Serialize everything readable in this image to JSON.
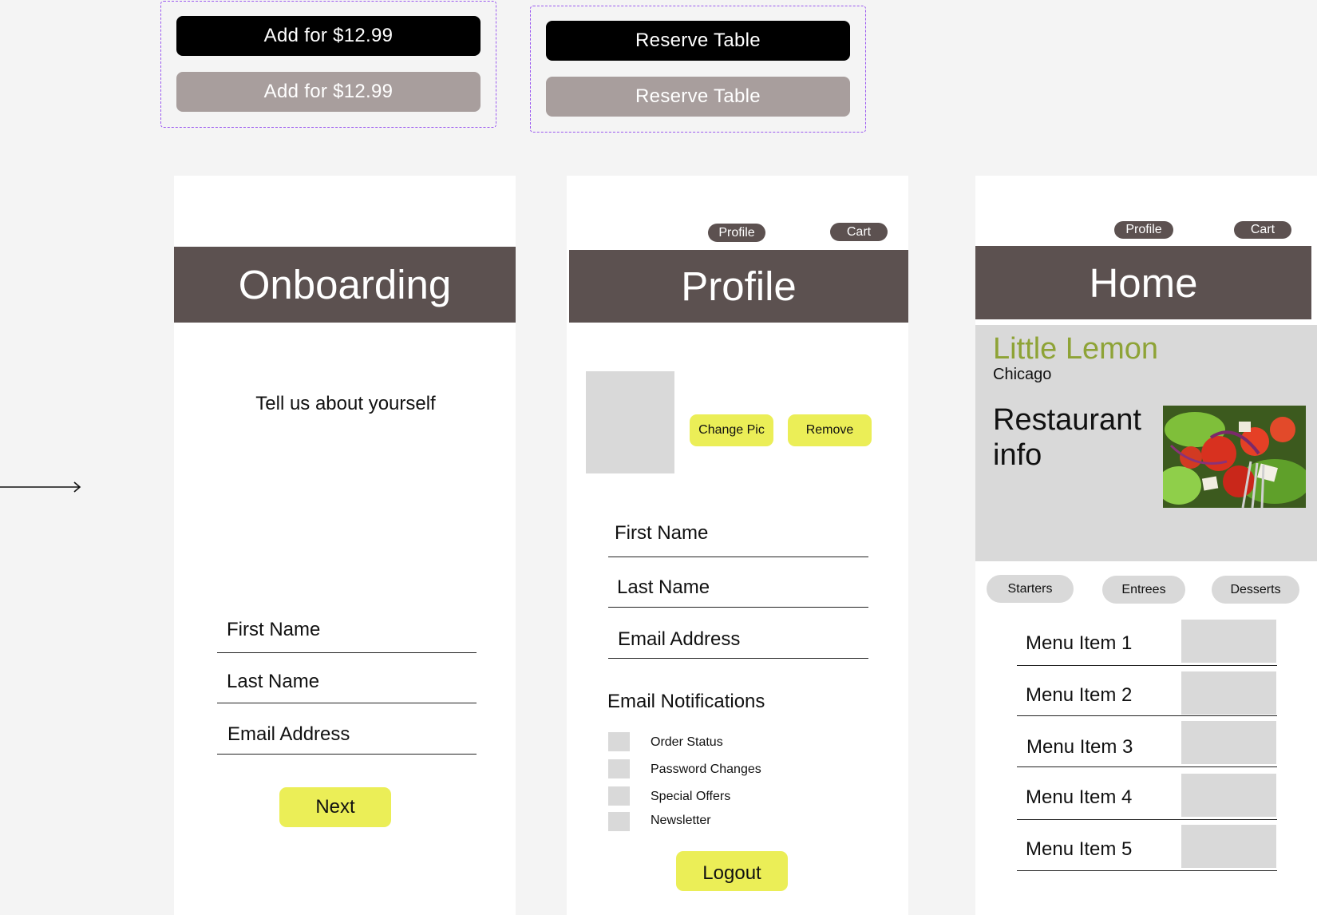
{
  "components": {
    "add_button_label": "Add for $12.99",
    "add_button_disabled_label": "Add for $12.99",
    "reserve_button_label": "Reserve Table",
    "reserve_button_disabled_label": "Reserve Table"
  },
  "onboarding": {
    "title": "Onboarding",
    "subtitle": "Tell us about yourself",
    "fields": [
      "First Name",
      "Last Name",
      "Email Address"
    ],
    "next_label": "Next"
  },
  "profile": {
    "nav": {
      "profile": "Profile",
      "cart": "Cart"
    },
    "title": "Profile",
    "change_pic_label": "Change Pic",
    "remove_label": "Remove",
    "fields": [
      "First Name",
      "Last Name",
      "Email Address"
    ],
    "notifications_heading": "Email Notifications",
    "notifications": [
      "Order Status",
      "Password Changes",
      "Special Offers",
      "Newsletter"
    ],
    "logout_label": "Logout"
  },
  "home": {
    "nav": {
      "profile": "Profile",
      "cart": "Cart"
    },
    "title": "Home",
    "restaurant_name": "Little Lemon",
    "city": "Chicago",
    "info_text": "Restaurant info",
    "categories": [
      "Starters",
      "Entrees",
      "Desserts"
    ],
    "menu_items": [
      "Menu Item 1",
      "Menu Item 2",
      "Menu Item 3",
      "Menu Item 4",
      "Menu Item 5"
    ]
  },
  "colors": {
    "header": "#5c5150",
    "accent_yellow": "#ebee57",
    "brand_green": "#8ea336",
    "disabled_gray": "#a89e9d",
    "placeholder_gray": "#d9d9d9"
  }
}
